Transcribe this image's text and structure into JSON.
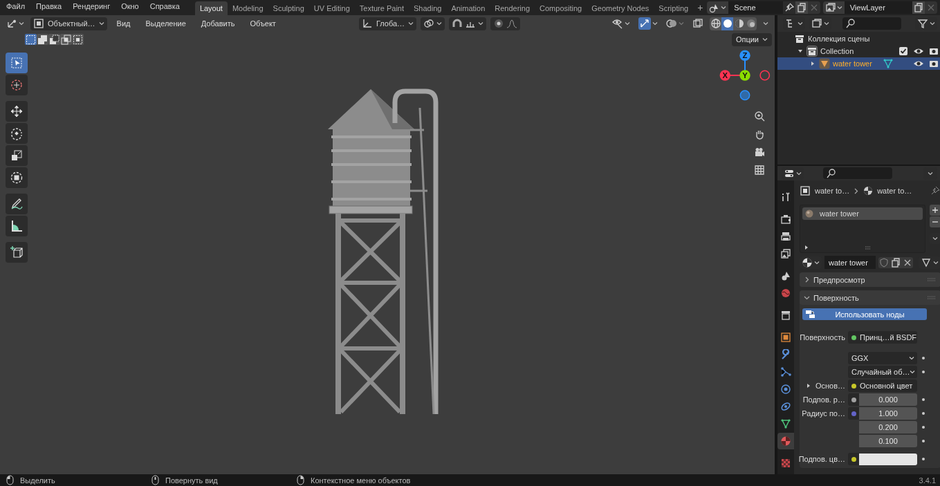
{
  "menu": [
    "Файл",
    "Правка",
    "Рендеринг",
    "Окно",
    "Справка"
  ],
  "workspaces": [
    {
      "label": "Layout",
      "selected": true
    },
    {
      "label": "Modeling",
      "selected": false
    },
    {
      "label": "Sculpting",
      "selected": false
    },
    {
      "label": "UV Editing",
      "selected": false
    },
    {
      "label": "Texture Paint",
      "selected": false
    },
    {
      "label": "Shading",
      "selected": false
    },
    {
      "label": "Animation",
      "selected": false
    },
    {
      "label": "Rendering",
      "selected": false
    },
    {
      "label": "Compositing",
      "selected": false
    },
    {
      "label": "Geometry Nodes",
      "selected": false
    },
    {
      "label": "Scripting",
      "selected": false
    }
  ],
  "add_workspace": "+",
  "scene": "Scene",
  "view_layer": "ViewLayer",
  "viewport": {
    "mode": "Объектный…",
    "menus": [
      "Вид",
      "Выделение",
      "Добавить",
      "Объект"
    ],
    "orientation": "Глоба…",
    "selection_modes": [
      {
        "kind": "set",
        "selected": true
      },
      {
        "kind": "extend",
        "selected": false
      },
      {
        "kind": "subtract",
        "selected": false
      },
      {
        "kind": "invert",
        "selected": false
      },
      {
        "kind": "intersect",
        "selected": false
      }
    ],
    "shading_modes": [
      {
        "kind": "wireframe",
        "selected": false
      },
      {
        "kind": "solid",
        "selected": true
      },
      {
        "kind": "material",
        "selected": false
      },
      {
        "kind": "rendered",
        "selected": false
      }
    ],
    "options": "Опции",
    "tools": [
      {
        "kind": "select",
        "selected": true
      },
      {
        "kind": "cursor",
        "selected": false
      },
      {
        "kind": "move",
        "selected": false
      },
      {
        "kind": "rotate",
        "selected": false
      },
      {
        "kind": "scale",
        "selected": false
      },
      {
        "kind": "transform",
        "selected": false
      },
      {
        "kind": "annotate",
        "selected": false
      },
      {
        "kind": "measure",
        "selected": false
      },
      {
        "kind": "add-cube",
        "selected": false
      }
    ],
    "gizmo": [
      {
        "label": "X",
        "color": "#ff3352"
      },
      {
        "label": "Y",
        "color": "#8bdc00"
      },
      {
        "label": "Z",
        "color": "#2890ff"
      }
    ]
  },
  "outliner": {
    "items": [
      {
        "kind": "scene-collection",
        "label": "Коллекция сцены",
        "children": [
          {
            "kind": "collection",
            "label": "Collection",
            "expanded": true,
            "selected": false,
            "children": [
              {
                "kind": "object",
                "label": "water tower",
                "expanded": false,
                "selected": true
              }
            ]
          }
        ]
      }
    ]
  },
  "properties": {
    "tabs": [
      {
        "kind": "tool",
        "selected": false
      },
      {
        "kind": "render",
        "selected": false
      },
      {
        "kind": "output",
        "selected": false
      },
      {
        "kind": "view-layer",
        "selected": false
      },
      {
        "kind": "scene",
        "selected": false
      },
      {
        "kind": "world",
        "selected": false
      },
      {
        "kind": "collection",
        "selected": false
      },
      {
        "kind": "object",
        "selected": false
      },
      {
        "kind": "modifiers",
        "selected": false
      },
      {
        "kind": "particles",
        "selected": false
      },
      {
        "kind": "physics",
        "selected": false
      },
      {
        "kind": "constraints",
        "selected": false
      },
      {
        "kind": "data",
        "selected": false
      },
      {
        "kind": "material",
        "selected": true
      },
      {
        "kind": "texture",
        "selected": false
      }
    ],
    "breadcrumb": [
      "water to…",
      "water to…"
    ],
    "material_slots": [
      {
        "label": "water tower",
        "selected": true
      }
    ],
    "material": "water tower",
    "panels": [
      {
        "label": "Предпросмотр",
        "expanded": false
      },
      {
        "label": "Поверхность",
        "expanded": true,
        "button": "Использовать ноды",
        "rows": [
          {
            "kind": "link",
            "label": "Поверхность",
            "value": "Принц…й BSDF",
            "socket": {
              "color": "#63c763"
            },
            "keyframe": false
          },
          {
            "kind": "menu",
            "value": "GGX",
            "keyframe": true
          },
          {
            "kind": "menu",
            "value": "Случайный об…",
            "keyframe": true
          },
          {
            "kind": "link",
            "label": "Основ…",
            "value": "Основной цвет",
            "socket": {
              "color": "#c7c729"
            },
            "expanded": false,
            "keyframe": false
          },
          {
            "kind": "number",
            "label": "Подпов. р…",
            "values": [
              "0.000"
            ],
            "socket": {
              "color": "#a1a1a1"
            },
            "keyframe": true
          },
          {
            "kind": "number",
            "label": "Радиус по…",
            "values": [
              "1.000",
              "0.200",
              "0.100"
            ],
            "socket": {
              "color": "#6363c7"
            },
            "keyframe": true
          },
          {
            "kind": "color",
            "label": "Подпов. цв…",
            "socket": {
              "color": "#c7c729"
            },
            "swatch": {
              "color": "#e6e6e6"
            },
            "keyframe": true
          }
        ]
      }
    ]
  },
  "status_bar": {
    "hints": [
      {
        "kind": "left-click",
        "label": "Выделить"
      },
      {
        "kind": "middle-click",
        "label": "Повернуть вид"
      },
      {
        "kind": "right-click",
        "label": "Контекстное меню объектов"
      }
    ],
    "version": "3.4.1"
  }
}
